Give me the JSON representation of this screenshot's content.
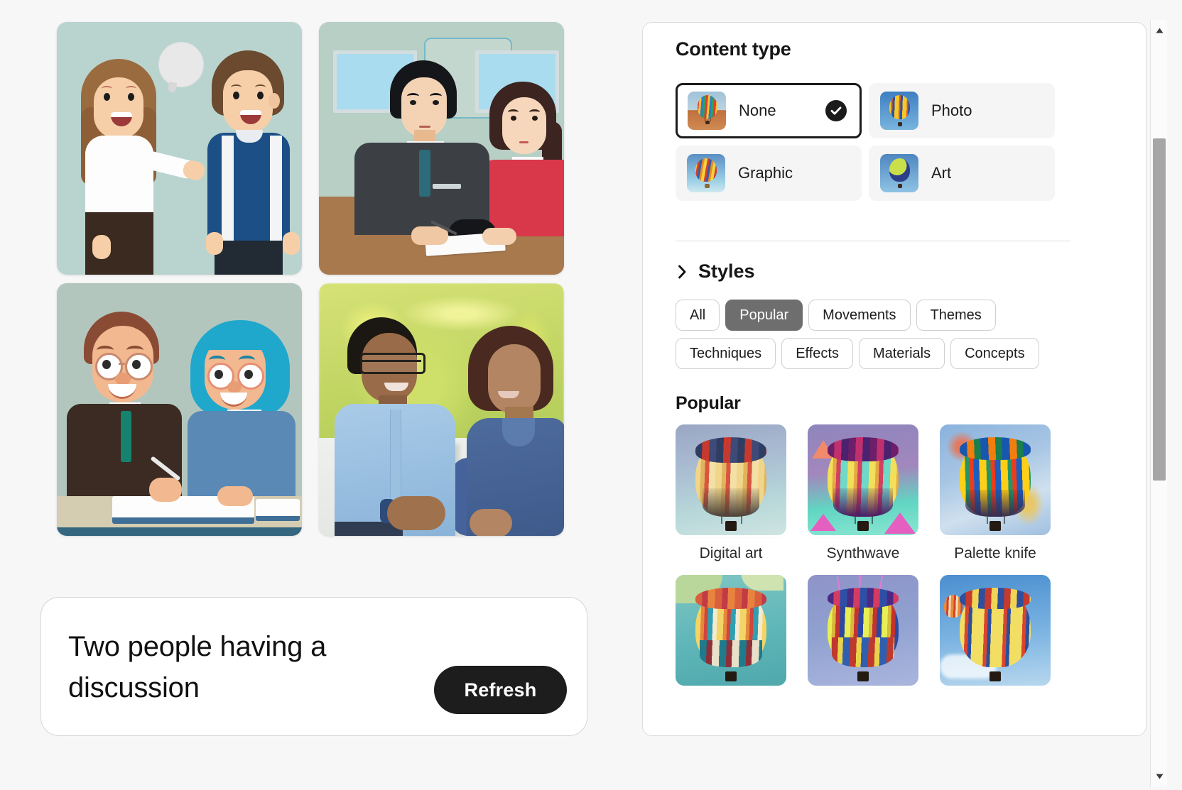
{
  "prompt": {
    "text": "Two people having a discussion",
    "refresh_label": "Refresh"
  },
  "results": [
    {
      "name": "illustration-two-people-talking-speech-bubble",
      "alt": "Cartoon illustration of a woman and a man talking with a speech bubble"
    },
    {
      "name": "illustration-office-meeting",
      "alt": "Illustration of a man in a suit and a woman in a red blazer at a desk"
    },
    {
      "name": "illustration-two-professionals-with-book",
      "alt": "Illustration of two smiling professionals with glasses reading a book"
    },
    {
      "name": "photo-two-people-outdoors",
      "alt": "Photo of a man in a blue shirt and a woman in a blue top talking outdoors"
    }
  ],
  "panel": {
    "content_type": {
      "title": "Content type",
      "options": [
        {
          "label": "None",
          "selected": true,
          "thumb": "balloon-desert"
        },
        {
          "label": "Photo",
          "selected": false,
          "thumb": "balloon-photo"
        },
        {
          "label": "Graphic",
          "selected": false,
          "thumb": "balloon-graphic"
        },
        {
          "label": "Art",
          "selected": false,
          "thumb": "balloon-art"
        }
      ],
      "check_icon": "check-icon"
    },
    "styles": {
      "title": "Styles",
      "expand_icon": "chevron-right-icon",
      "filters": [
        {
          "label": "All",
          "active": false
        },
        {
          "label": "Popular",
          "active": true
        },
        {
          "label": "Movements",
          "active": false
        },
        {
          "label": "Themes",
          "active": false
        },
        {
          "label": "Techniques",
          "active": false
        },
        {
          "label": "Effects",
          "active": false
        },
        {
          "label": "Materials",
          "active": false
        },
        {
          "label": "Concepts",
          "active": false
        }
      ],
      "group_title": "Popular",
      "items": [
        {
          "label": "Digital art",
          "thumb": "balloon-digital-art"
        },
        {
          "label": "Synthwave",
          "thumb": "balloon-synthwave"
        },
        {
          "label": "Palette knife",
          "thumb": "balloon-palette-knife"
        },
        {
          "label": "",
          "thumb": "balloon-row2-a"
        },
        {
          "label": "",
          "thumb": "balloon-row2-b"
        },
        {
          "label": "",
          "thumb": "balloon-row2-c"
        }
      ]
    }
  },
  "scrollbar": {
    "up_arrow": "triangle-up-icon",
    "down_arrow": "triangle-down-icon"
  },
  "colors": {
    "accent_dark": "#1d1d1d",
    "chip_active_bg": "#6e6e6e",
    "panel_bg": "#ffffff",
    "app_bg": "#f7f7f7",
    "selected_border": "#1b1b1b"
  }
}
